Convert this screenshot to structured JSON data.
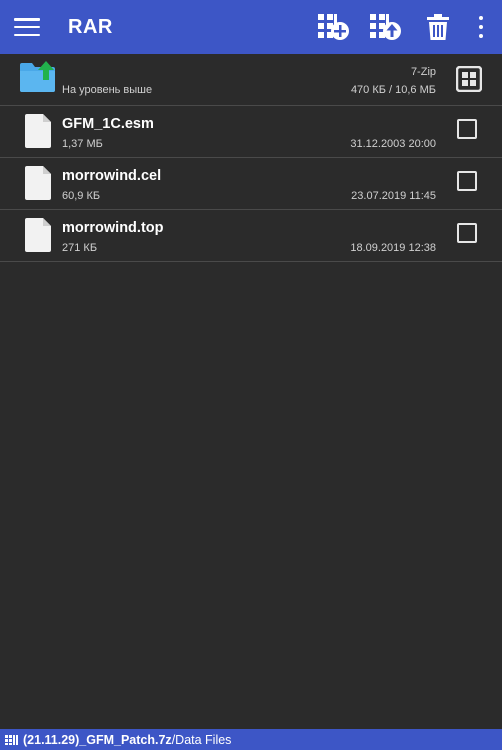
{
  "app": {
    "title": "RAR"
  },
  "toolbar": {
    "add_icon": "archive-add-icon",
    "extract_icon": "archive-extract-icon",
    "delete_icon": "trash-icon",
    "overflow_icon": "more-vert-icon",
    "menu_icon": "hamburger-menu-icon"
  },
  "parent_row": {
    "label": "На уровень выше",
    "type": "7-Zip",
    "size_info": "470 КБ / 10,6 МБ",
    "icon": "folder-up-icon",
    "select_all_icon": "select-all-icon"
  },
  "files": [
    {
      "name": "GFM_1C.esm",
      "size": "1,37 МБ",
      "date": "31.12.2003 20:00",
      "icon": "file-icon"
    },
    {
      "name": "morrowind.cel",
      "size": "60,9 КБ",
      "date": "23.07.2019 11:45",
      "icon": "file-icon"
    },
    {
      "name": "morrowind.top",
      "size": "271 КБ",
      "date": "18.09.2019 12:38",
      "icon": "file-icon"
    }
  ],
  "status": {
    "archive": "(21.11.29)_GFM_Patch.7z",
    "folder": "/Data Files",
    "icon": "archive-icon"
  },
  "colors": {
    "accent": "#3d56c6",
    "background": "#2b2b2b",
    "divider": "#4a4a4a",
    "folder": "#4aa8e8",
    "folder_arrow": "#22b24c"
  }
}
